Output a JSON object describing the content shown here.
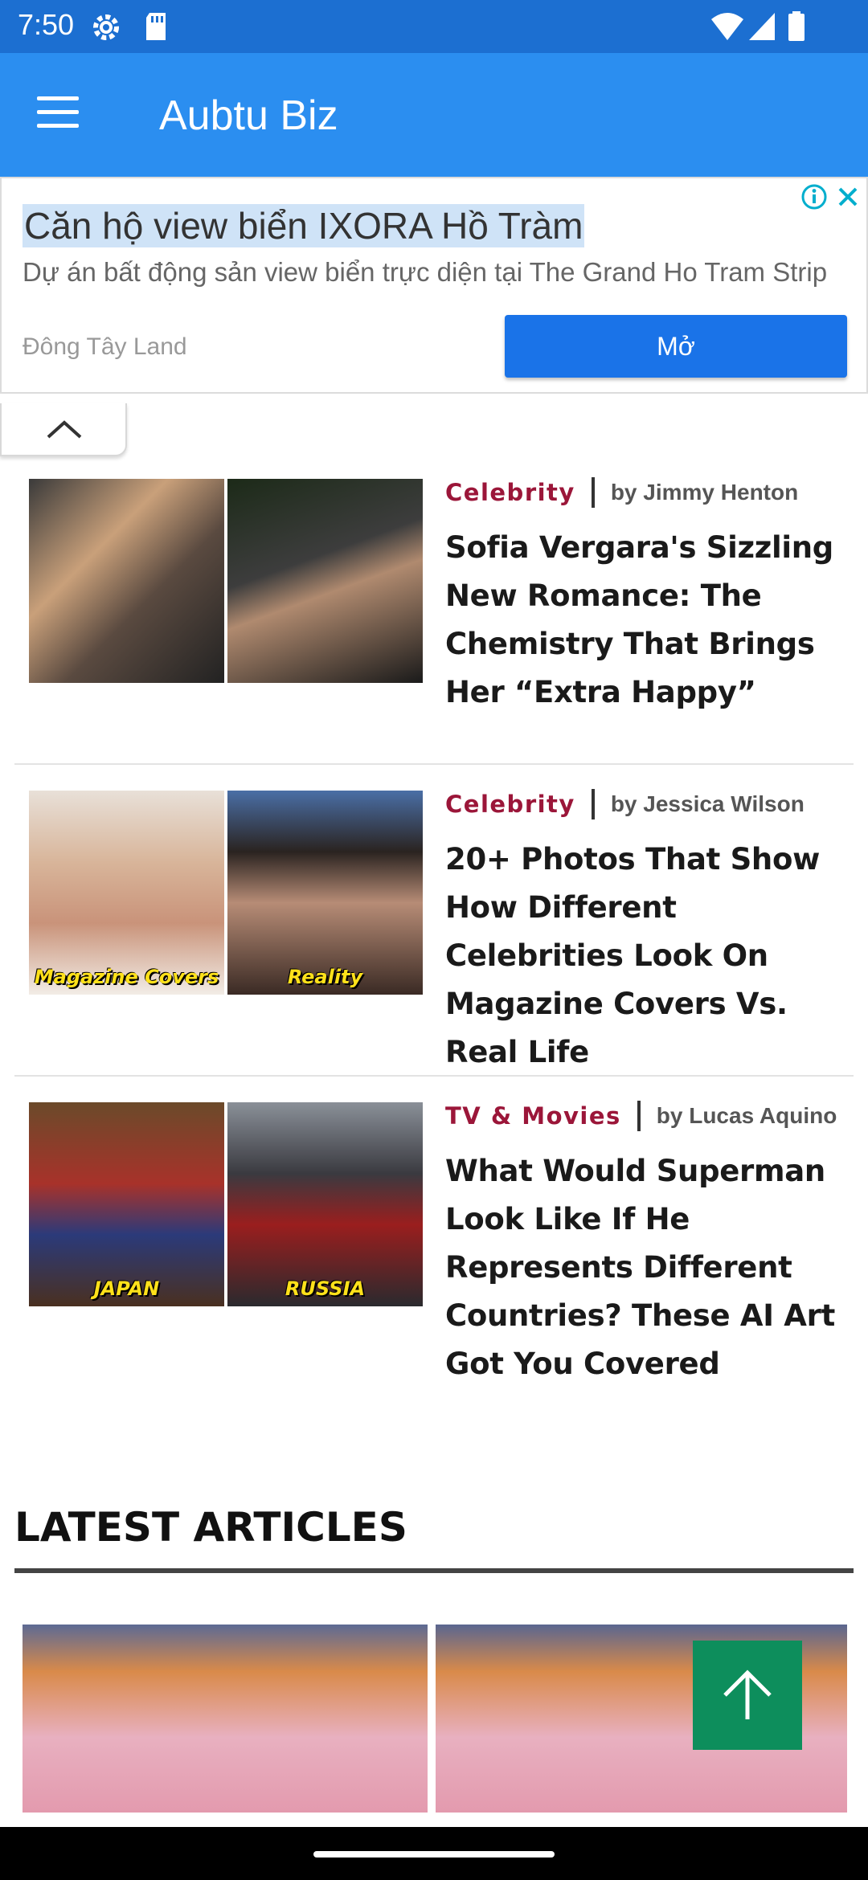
{
  "status_bar": {
    "time": "7:50",
    "icons": [
      "settings-icon",
      "sd-card-icon",
      "wifi-icon",
      "signal-icon",
      "battery-icon"
    ]
  },
  "app_bar": {
    "title": "Aubtu Biz",
    "menu_icon": "hamburger-menu-icon"
  },
  "ad": {
    "headline": "Căn hộ view biển IXORA Hồ Tràm",
    "description": "Dự án bất động sản view biển trực diện tại The Grand Ho Tram Strip",
    "advertiser": "Đông Tây Land",
    "open_label": "Mở",
    "info_icon": "info-icon",
    "close_icon": "close-icon",
    "collapse_icon": "chevron-up-icon"
  },
  "articles": [
    {
      "category": "Celebrity",
      "author": "by Jimmy Henton",
      "title": "Sofia Vergara's Sizzling New Romance: The Chemistry That Brings Her “Extra Happy”"
    },
    {
      "category": "Celebrity",
      "author": "by Jessica Wilson",
      "title": "20+ Photos That Show How Different Celebrities Look On Magazine Covers Vs. Real Life",
      "thumb_captions": [
        "Magazine Covers",
        "Reality"
      ]
    },
    {
      "category": "TV & Movies",
      "author": "by Lucas Aquino",
      "title": "What Would Superman Look Like If He Represents Different Countries? These AI Art Got You Covered",
      "thumb_captions": [
        "JAPAN",
        "RUSSIA"
      ]
    }
  ],
  "latest": {
    "heading": "LATEST ARTICLES"
  },
  "scroll_top_icon": "arrow-up-icon",
  "colors": {
    "status_bar": "#1c6fd1",
    "app_bar": "#2b8ef0",
    "category": "#9b1639",
    "ad_button": "#1a73e8",
    "scroll_top": "#0d8e5c"
  }
}
